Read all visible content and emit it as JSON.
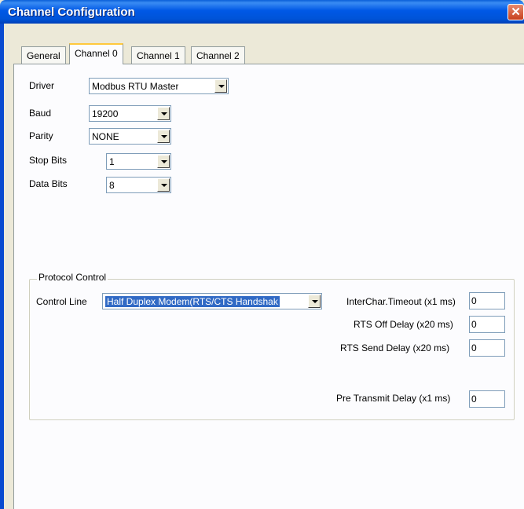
{
  "window": {
    "title": "Channel Configuration",
    "close_glyph": "✕"
  },
  "tabs": [
    {
      "label": "General"
    },
    {
      "label": "Channel 0"
    },
    {
      "label": "Channel 1"
    },
    {
      "label": "Channel 2"
    }
  ],
  "fields": {
    "driver": {
      "label": "Driver",
      "value": "Modbus RTU Master"
    },
    "baud": {
      "label": "Baud",
      "value": "19200"
    },
    "parity": {
      "label": "Parity",
      "value": "NONE"
    },
    "stop_bits": {
      "label": "Stop Bits",
      "value": "1"
    },
    "data_bits": {
      "label": "Data Bits",
      "value": "8"
    }
  },
  "protocol": {
    "title": "Protocol Control",
    "control_line_label": "Control Line",
    "control_line_value": "Half Duplex Modem(RTS/CTS Handshak",
    "interchar_label": "InterChar.Timeout (x1 ms)",
    "interchar_value": "0",
    "rts_off_label": "RTS Off Delay (x20 ms)",
    "rts_off_value": "0",
    "rts_send_label": "RTS Send Delay (x20 ms)",
    "rts_send_value": "0",
    "pre_transmit_label": "Pre Transmit Delay (x1 ms)",
    "pre_transmit_value": "0"
  }
}
